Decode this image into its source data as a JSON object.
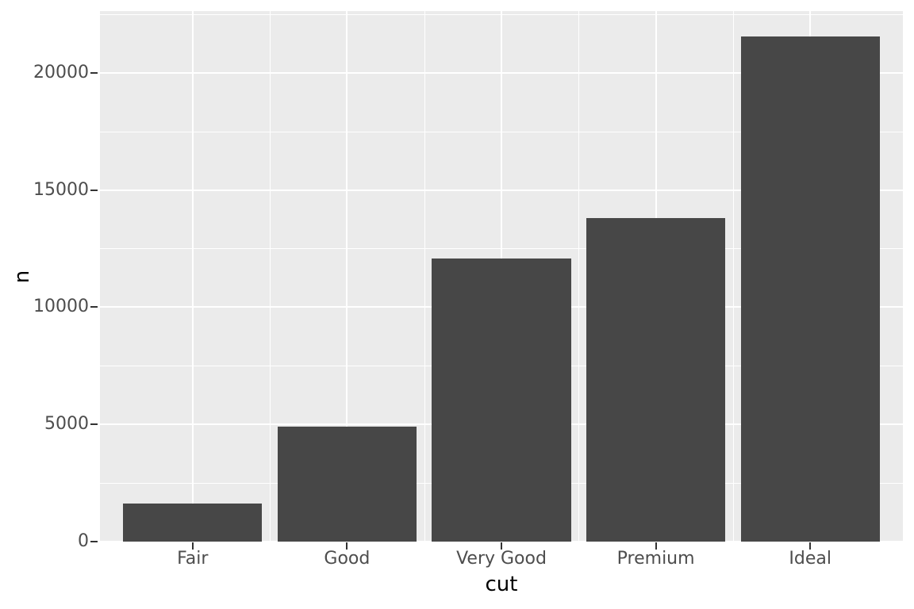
{
  "chart_data": {
    "type": "bar",
    "title": "",
    "subtitle": "",
    "xlabel": "cut",
    "ylabel": "n",
    "categories": [
      "Fair",
      "Good",
      "Very Good",
      "Premium",
      "Ideal"
    ],
    "values": [
      1610,
      4906,
      12082,
      13791,
      21551
    ],
    "series": [
      {
        "name": "n",
        "values": [
          1610,
          4906,
          12082,
          13791,
          21551
        ]
      }
    ],
    "ylim": [
      0,
      22628
    ],
    "xlim": [
      0.4,
      5.6
    ],
    "y_ticks": [
      0,
      5000,
      10000,
      15000,
      20000
    ],
    "y_tick_labels": [
      "0",
      "5000",
      "10000",
      "15000",
      "20000"
    ],
    "y_minor_ticks": [
      2500,
      7500,
      12500,
      17500,
      22500
    ],
    "x_tick_labels": [
      "Fair",
      "Good",
      "Very Good",
      "Premium",
      "Ideal"
    ],
    "grid": true,
    "legend": false,
    "legend_position": "none",
    "annotations": [],
    "colors": {
      "bar_fill": "#474747",
      "panel_background": "#EBEBEB",
      "grid_line": "#FFFFFF",
      "axis_text": "#4D4D4D",
      "axis_title": "#000000",
      "tick_mark": "#333333",
      "plot_background": "#FFFFFF"
    },
    "bar_width_ratio": 0.9,
    "theme": "theme_grey"
  }
}
